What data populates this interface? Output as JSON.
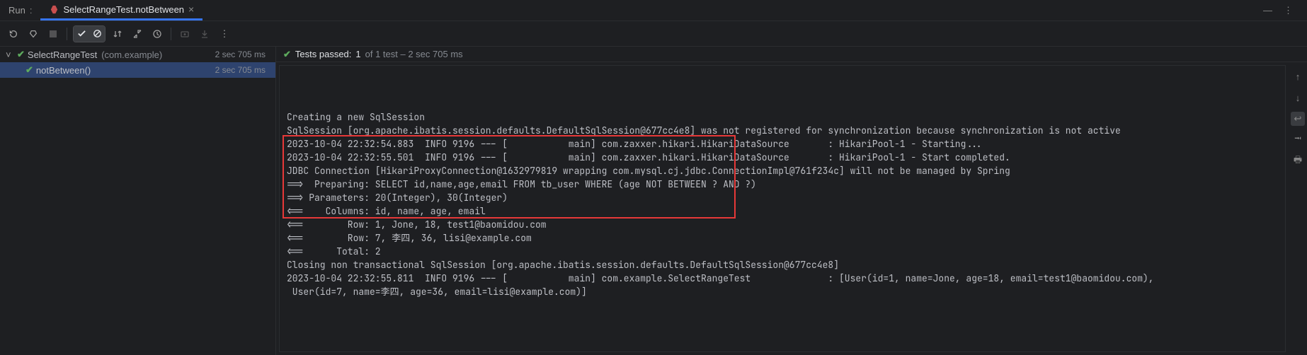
{
  "tabs": {
    "run_label": "Run",
    "active_label": "SelectRangeTest.notBetween"
  },
  "summary": {
    "prefix": "Tests passed:",
    "count": "1",
    "rest": "of 1 test – 2 sec 705 ms"
  },
  "tree": {
    "class_name": "SelectRangeTest",
    "class_pkg": "(com.example)",
    "class_time": "2 sec 705 ms",
    "method_name": "notBetween()",
    "method_time": "2 sec 705 ms"
  },
  "console": {
    "lines": [
      "Creating a new SqlSession",
      "SqlSession [org.apache.ibatis.session.defaults.DefaultSqlSession@677cc4e8] was not registered for synchronization because synchronization is not active",
      "2023-10-04 22:32:54.883  INFO 9196 --- [           main] com.zaxxer.hikari.HikariDataSource       : HikariPool-1 - Starting...",
      "2023-10-04 22:32:55.501  INFO 9196 --- [           main] com.zaxxer.hikari.HikariDataSource       : HikariPool-1 - Start completed.",
      "JDBC Connection [HikariProxyConnection@1632979819 wrapping com.mysql.cj.jdbc.ConnectionImpl@761f234c] will not be managed by Spring",
      "==>  Preparing: SELECT id,name,age,email FROM tb_user WHERE (age NOT BETWEEN ? AND ?)",
      "==> Parameters: 20(Integer), 30(Integer)",
      "<==    Columns: id, name, age, email",
      "<==        Row: 1, Jone, 18, test1@baomidou.com",
      "<==        Row: 7, 李四, 36, lisi@example.com",
      "<==      Total: 2",
      "Closing non transactional SqlSession [org.apache.ibatis.session.defaults.DefaultSqlSession@677cc4e8]",
      "2023-10-04 22:32:55.811  INFO 9196 --- [           main] com.example.SelectRangeTest              : [User(id=1, name=Jone, age=18, email=test1@baomidou.com),",
      " User(id=7, name=李四, age=36, email=lisi@example.com)]"
    ]
  }
}
